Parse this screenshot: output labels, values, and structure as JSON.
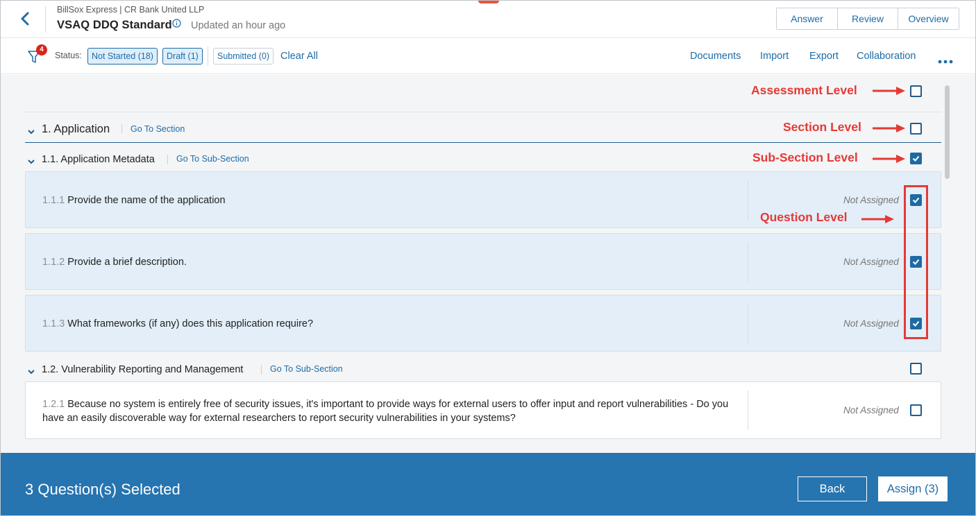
{
  "header": {
    "breadcrumb": "BillSox Express | CR Bank United LLP",
    "title": "VSAQ DDQ Standard",
    "updated": "Updated an hour ago",
    "modes": [
      "Answer",
      "Review",
      "Overview"
    ]
  },
  "filterbar": {
    "badge_count": "4",
    "status_label": "Status:",
    "chips": [
      {
        "label": "Not Started (18)",
        "active": true
      },
      {
        "label": "Draft (1)",
        "active": true
      },
      {
        "label": "Submitted (0)",
        "active": false
      }
    ],
    "clear_all": "Clear All",
    "links": [
      "Documents",
      "Import",
      "Export",
      "Collaboration"
    ]
  },
  "content": {
    "section": {
      "title": "1. Application",
      "go_link": "Go To Section"
    },
    "subsections": [
      {
        "title": "1.1. Application Metadata",
        "go_link": "Go To Sub-Section",
        "checked": true,
        "questions": [
          {
            "num": "1.1.1",
            "text": "Provide the name of the application",
            "assignee": "Not Assigned",
            "checked": true
          },
          {
            "num": "1.1.2",
            "text": "Provide a brief description.",
            "assignee": "Not Assigned",
            "checked": true
          },
          {
            "num": "1.1.3",
            "text": "What frameworks (if any) does this application require?",
            "assignee": "Not Assigned",
            "checked": true
          }
        ]
      },
      {
        "title": "1.2. Vulnerability Reporting and Management",
        "go_link": "Go To Sub-Section",
        "checked": false,
        "questions": [
          {
            "num": "1.2.1",
            "text": "Because no system is entirely free of security issues, it's important to provide ways for external users to offer input and report vulnerabilities - Do you have an easily discoverable way for external researchers to report security vulnerabilities in your systems?",
            "assignee": "Not Assigned",
            "checked": false
          }
        ]
      }
    ]
  },
  "annotations": {
    "assessment": "Assessment Level",
    "section": "Section Level",
    "subsection": "Sub-Section Level",
    "question": "Question Level",
    "color": "#e53935"
  },
  "footer": {
    "selected_text": "3 Question(s) Selected",
    "back": "Back",
    "assign": "Assign (3)"
  },
  "colors": {
    "accent": "#1c6ca8",
    "footer_bg": "#2674b0",
    "selected_card_bg": "#e3eef8",
    "badge": "#d9241c"
  }
}
